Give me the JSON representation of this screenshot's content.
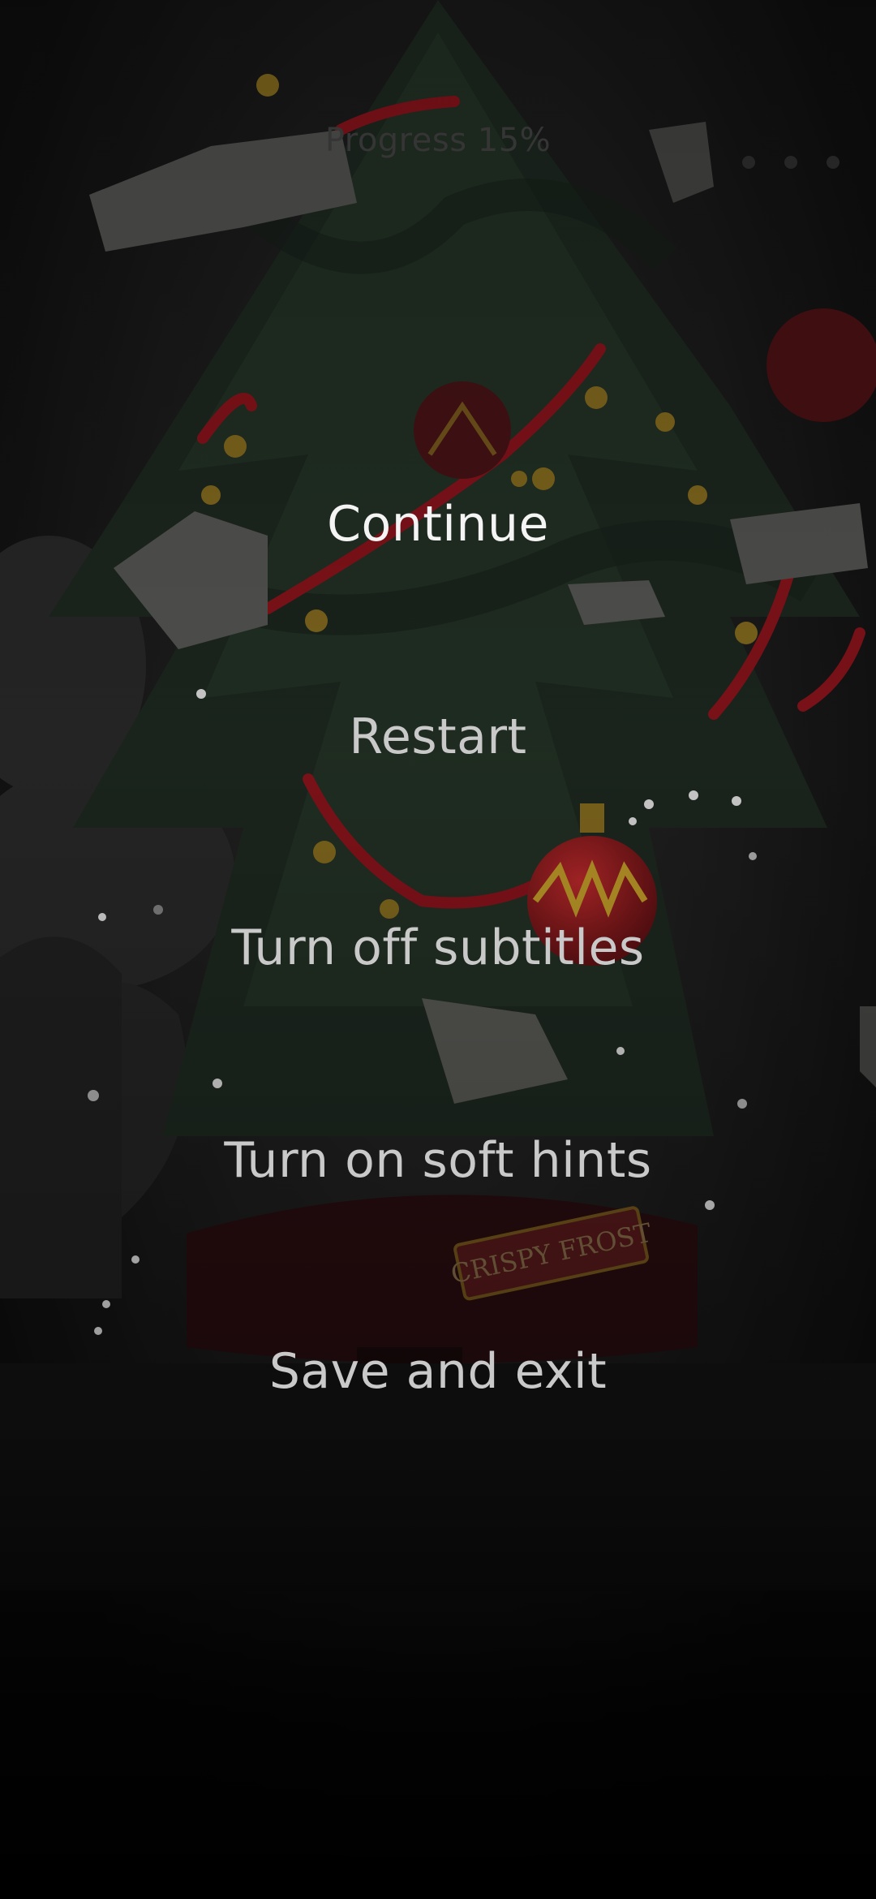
{
  "hud": {
    "progress_label": "Progress 15%",
    "more_icon": "more-dots-icon"
  },
  "pause_menu": {
    "items": [
      {
        "label": "Continue"
      },
      {
        "label": "Restart"
      },
      {
        "label": "Turn off subtitles"
      },
      {
        "label": "Turn on soft hints"
      },
      {
        "label": "Save and exit"
      }
    ]
  },
  "scene": {
    "stand_sign_text": "CRISPY FROST"
  },
  "colors": {
    "menu_primary": "#f4f4f4",
    "menu_secondary": "#c9c9c9",
    "garland": "#a51620",
    "ornament_gold": "#c9a22a",
    "tree_green": "#1f2b22"
  }
}
